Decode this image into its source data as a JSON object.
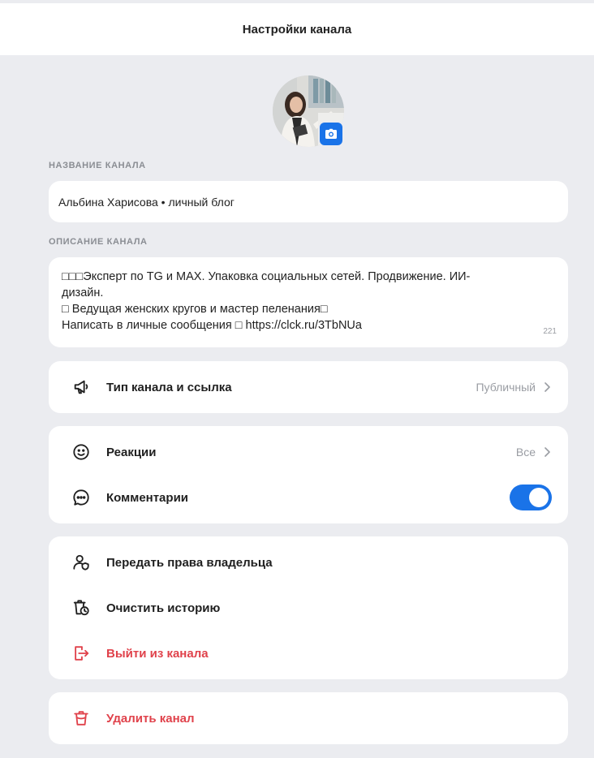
{
  "header": {
    "title": "Настройки канала"
  },
  "avatar": {
    "camera_icon": "camera-icon"
  },
  "channel_name": {
    "label": "НАЗВАНИЕ КАНАЛА",
    "value": "Альбина Харисова • личный блог"
  },
  "channel_description": {
    "label": "ОПИСАНИЕ КАНАЛА",
    "lines": [
      "□□□Эксперт по TG и MAX. Упаковка социальных сетей. Продвижение. ИИ-",
      "дизайн.",
      "□ Ведущая женских кругов и мастер пеленания□",
      "Написать в личные сообщения □ https://clck.ru/3TbNUa"
    ],
    "counter": "221"
  },
  "channel_type": {
    "label": "Тип канала и ссылка",
    "value": "Публичный",
    "icon": "megaphone-icon"
  },
  "reactions": {
    "label": "Реакции",
    "value": "Все",
    "icon": "smile-icon"
  },
  "comments": {
    "label": "Комментарии",
    "enabled": true,
    "icon": "comment-icon"
  },
  "actions": {
    "transfer_owner": {
      "label": "Передать права владельца",
      "icon": "user-shield-icon"
    },
    "clear_history": {
      "label": "Очистить историю",
      "icon": "trash-clock-icon"
    },
    "leave_channel": {
      "label": "Выйти из канала",
      "icon": "exit-icon"
    }
  },
  "delete_channel": {
    "label": "Удалить канал",
    "icon": "delete-icon"
  },
  "colors": {
    "accent": "#1a73e8",
    "danger": "#e0424b",
    "background": "#ebecf0",
    "card": "#ffffff",
    "muted": "#9a9da3"
  }
}
